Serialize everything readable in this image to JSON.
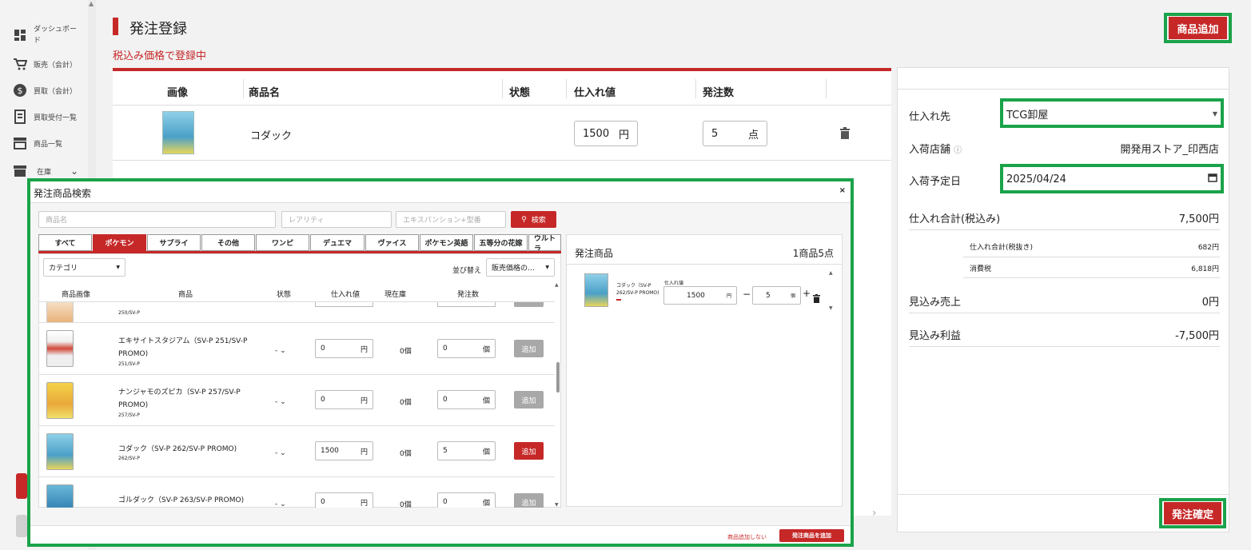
{
  "sidebar": {
    "items": [
      {
        "label": "ダッシュボード",
        "icon": "dashboard-icon"
      },
      {
        "label": "販売（会計）",
        "icon": "cart-icon"
      },
      {
        "label": "買取（会計）",
        "icon": "dollar-icon"
      },
      {
        "label": "買取受付一覧",
        "icon": "receipt-icon"
      },
      {
        "label": "商品一覧",
        "icon": "store-icon"
      },
      {
        "label": "在庫",
        "icon": "archive-icon"
      }
    ]
  },
  "header": {
    "title": "発注登録",
    "subtitle": "税込み価格で登録中",
    "add_product_label": "商品追加"
  },
  "order_table": {
    "columns": [
      "画像",
      "商品名",
      "状態",
      "仕入れ値",
      "発注数"
    ],
    "rows": [
      {
        "name": "コダック",
        "price": "1500",
        "price_unit": "円",
        "qty": "5",
        "qty_unit": "点"
      }
    ]
  },
  "right_panel": {
    "supplier_label": "仕入れ先",
    "supplier_value": "TCG卸屋",
    "store_label": "入荷店舗",
    "store_value": "開発用ストア_印西店",
    "date_label": "入荷予定日",
    "date_value": "2025/04/24",
    "total_label": "仕入れ合計(税込み)",
    "total_value": "7,500円",
    "subtotal_label": "仕入れ合計(税抜き)",
    "subtotal_value": "682円",
    "tax_label": "消費税",
    "tax_value": "6,818円",
    "expected_sales_label": "見込み売上",
    "expected_sales_value": "0円",
    "expected_profit_label": "見込み利益",
    "expected_profit_value": "-7,500円",
    "confirm_label": "発注確定"
  },
  "modal": {
    "title": "発注商品検索",
    "close": "×",
    "search": {
      "name_placeholder": "商品名",
      "rarity_placeholder": "レアリティ",
      "expansion_placeholder": "エキスパンション+型番",
      "search_label": "検索"
    },
    "tabs": [
      "すべて",
      "ポケモン",
      "サプライ",
      "その他",
      "ワンピ",
      "デュエマ",
      "ヴァイス",
      "ポケモン英語",
      "五等分の花嫁",
      "ウルトラ"
    ],
    "active_tab": 1,
    "category_label": "カテゴリ",
    "sort_label": "並び替え",
    "sort_value": "販売価格の…",
    "columns": [
      "商品画像",
      "商品",
      "状態",
      "仕入れ値",
      "現在庫",
      "発注数"
    ],
    "partial_row_code": "250/SV-P",
    "rows": [
      {
        "name": "エキサイトスタジアム（SV-P 251/SV-P PROMO)",
        "code": "251/SV-P",
        "state": "-",
        "price": "0",
        "stock": "0個",
        "qty": "0",
        "add": "追加",
        "active": false
      },
      {
        "name": "ナンジャモのズピカ（SV-P 257/SV-P PROMO)",
        "code": "257/SV-P",
        "state": "-",
        "price": "0",
        "stock": "0個",
        "qty": "0",
        "add": "追加",
        "active": false
      },
      {
        "name": "コダック（SV-P 262/SV-P PROMO)",
        "code": "262/SV-P",
        "state": "-",
        "price": "1500",
        "stock": "0個",
        "qty": "5",
        "add": "追加",
        "active": true
      },
      {
        "name": "ゴルダック（SV-P 263/SV-P PROMO)",
        "code": "",
        "state": "-",
        "price": "0",
        "stock": "0個",
        "qty": "0",
        "add": "追加",
        "active": false
      }
    ],
    "price_unit": "円",
    "qty_unit": "個",
    "cart": {
      "title": "発注商品",
      "summary": "1商品5点",
      "item_name": "コダック（SV-P 262/SV-P PROMO)",
      "price_label": "仕入れ値",
      "price": "1500",
      "price_unit": "円",
      "qty": "5",
      "qty_unit": "個"
    },
    "footer": {
      "cancel_label": "商品追加しない",
      "confirm_label": "発注商品を追加"
    }
  },
  "colors": {
    "accent": "#c62828",
    "highlight": "#1aa34a"
  }
}
